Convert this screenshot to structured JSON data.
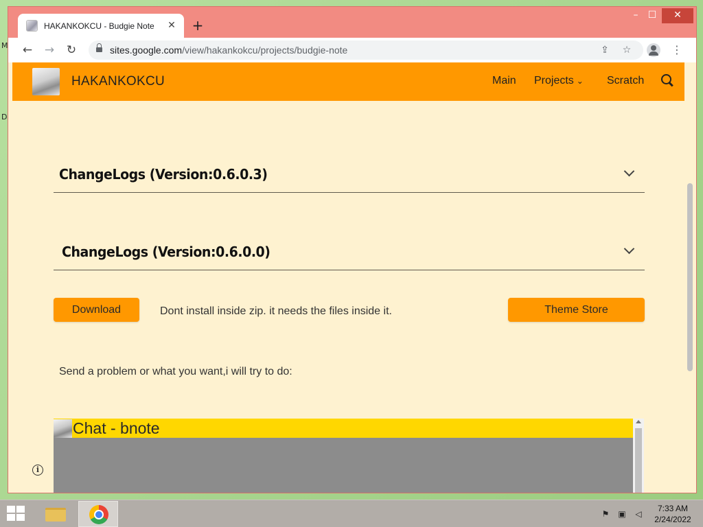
{
  "desktop": {
    "glyph_top": "M",
    "glyph_mid": "D"
  },
  "browser": {
    "tab": {
      "title": "HAKANKOKCU - Budgie Note",
      "close": "✕"
    },
    "new_tab": "+",
    "window_controls": {
      "minimize": "–",
      "maximize": "☐",
      "close": "✕"
    },
    "nav": {
      "back": "←",
      "forward": "→",
      "reload": "↻"
    },
    "url": {
      "host": "sites.google.com",
      "path": "/view/hakankokcu/projects/budgie-note"
    },
    "menu": "⋮"
  },
  "site": {
    "name": "HAKANKOKCU",
    "nav": {
      "main": "Main",
      "projects": "Projects",
      "scratch": "Scratch"
    }
  },
  "content": {
    "changelogs": [
      {
        "title": "ChangeLogs (Version:0.6.0.3)"
      },
      {
        "title": "ChangeLogs (Version:0.6.0.0)"
      }
    ],
    "download_button": "Download",
    "install_note": "Dont install inside zip. it needs the files inside it.",
    "theme_store_button": "Theme Store",
    "feedback_prompt": "Send a problem or what you want,i will try to do:",
    "chat": {
      "title": "Chat - bnote"
    },
    "info": "i"
  },
  "taskbar": {
    "time": "7:33 AM",
    "date": "2/24/2022"
  }
}
